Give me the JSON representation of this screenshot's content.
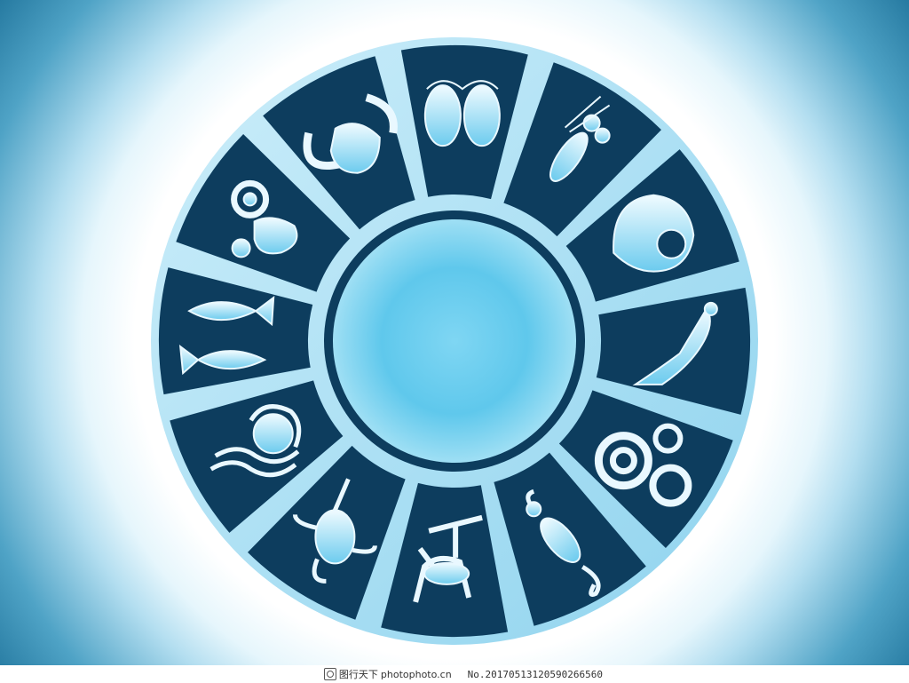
{
  "image": {
    "subject": "zodiac wheel",
    "colors": {
      "ring_dark": "#0d3d5e",
      "inner_ring": "#0d3d5e",
      "center_light": "#9fe0f6",
      "center_mid": "#55c4ea",
      "divider_light": "#a8dcef",
      "icon_light": "#e9f8ff",
      "icon_mid": "#7fd0ee"
    },
    "segments": [
      {
        "sign": "gemini",
        "icon": "gemini-twins-icon"
      },
      {
        "sign": "cancer",
        "icon": "cancer-lobster-icon"
      },
      {
        "sign": "leo",
        "icon": "leo-lion-icon"
      },
      {
        "sign": "virgo",
        "icon": "virgo-woman-icon"
      },
      {
        "sign": "libra",
        "icon": "libra-swirls-icon"
      },
      {
        "sign": "scorpio",
        "icon": "scorpio-scorpion-icon"
      },
      {
        "sign": "sagittarius",
        "icon": "sagittarius-centaur-icon"
      },
      {
        "sign": "capricorn",
        "icon": "capricorn-seagoat-icon"
      },
      {
        "sign": "aquarius",
        "icon": "aquarius-face-icon"
      },
      {
        "sign": "pisces",
        "icon": "pisces-fish-icon"
      },
      {
        "sign": "aries",
        "icon": "aries-ram-icon"
      },
      {
        "sign": "taurus",
        "icon": "taurus-bull-icon"
      }
    ]
  },
  "watermark": {
    "logo_text": "图行天下",
    "url": "photophoto.cn",
    "id_text": "No.20170513120590266560"
  }
}
